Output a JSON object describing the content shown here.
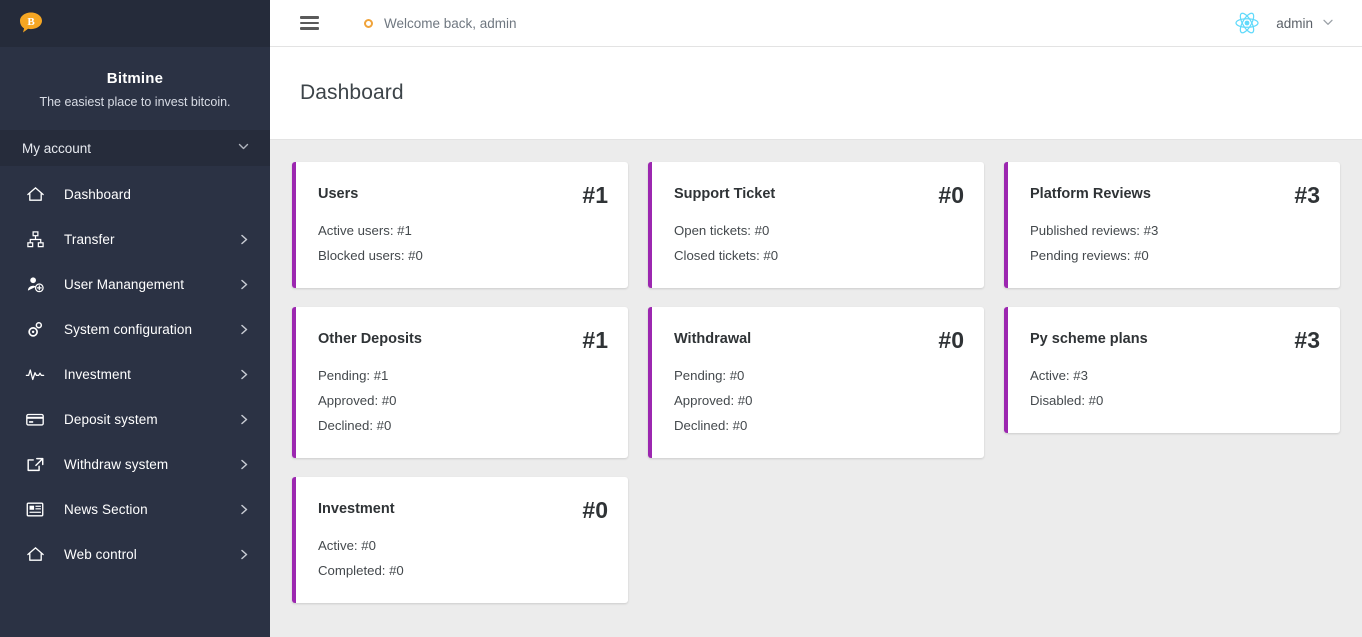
{
  "brand": {
    "logo_icon": "bitcoin-chat-bubble-icon",
    "name": "Bitmine",
    "tagline": "The easiest place to invest bitcoin.",
    "accent_orange": "#f5a623"
  },
  "sidebar": {
    "section_label": "My account",
    "section_chevron": "chevron-down-icon",
    "bg_color": "#2b3244",
    "items": [
      {
        "label": "Dashboard",
        "icon": "home-icon",
        "has_arrow": false
      },
      {
        "label": "Transfer",
        "icon": "sitemap-icon",
        "has_arrow": true
      },
      {
        "label": "User Manangement",
        "icon": "user-plus-icon",
        "has_arrow": true
      },
      {
        "label": "System configuration",
        "icon": "gears-icon",
        "has_arrow": true
      },
      {
        "label": "Investment",
        "icon": "pulse-icon",
        "has_arrow": true
      },
      {
        "label": "Deposit system",
        "icon": "credit-card-icon",
        "has_arrow": true
      },
      {
        "label": "Withdraw system",
        "icon": "share-export-icon",
        "has_arrow": true
      },
      {
        "label": "News Section",
        "icon": "news-paper-icon",
        "has_arrow": true
      },
      {
        "label": "Web control",
        "icon": "home-icon",
        "has_arrow": true
      }
    ]
  },
  "topbar": {
    "menu_icon": "hamburger-icon",
    "status_icon": "orange-ring-icon",
    "welcome_text": "Welcome back, admin",
    "app_icon": "react-logo-icon",
    "app_icon_color": "#61dafb",
    "user_name": "admin",
    "user_caret": "chevron-down-icon"
  },
  "page": {
    "title": "Dashboard"
  },
  "cards": [
    {
      "title": "Users",
      "count": "#1",
      "lines": [
        "Active users: #1",
        "Blocked users: #0"
      ],
      "accent": "#9c27b0"
    },
    {
      "title": "Support Ticket",
      "count": "#0",
      "lines": [
        "Open tickets: #0",
        "Closed tickets: #0"
      ],
      "accent": "#9c27b0"
    },
    {
      "title": "Platform Reviews",
      "count": "#3",
      "lines": [
        "Published reviews: #3",
        "Pending reviews: #0"
      ],
      "accent": "#9c27b0"
    },
    {
      "title": "Other Deposits",
      "count": "#1",
      "lines": [
        "Pending: #1",
        "Approved: #0",
        "Declined: #0"
      ],
      "accent": "#9c27b0"
    },
    {
      "title": "Withdrawal",
      "count": "#0",
      "lines": [
        "Pending: #0",
        "Approved: #0",
        "Declined: #0"
      ],
      "accent": "#9c27b0"
    },
    {
      "title": "Py scheme plans",
      "count": "#3",
      "lines": [
        "Active: #3",
        "Disabled: #0"
      ],
      "accent": "#9c27b0"
    },
    {
      "title": "Investment",
      "count": "#0",
      "lines": [
        "Active: #0",
        "Completed: #0"
      ],
      "accent": "#9c27b0"
    }
  ]
}
